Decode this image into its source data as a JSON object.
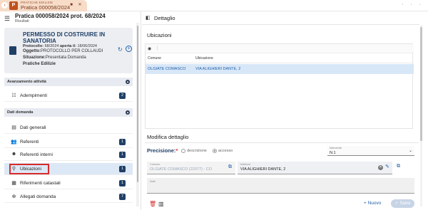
{
  "tab": {
    "app_name": "PRATICHE EDILIZIE",
    "title": "Pratica 000058/2024",
    "pin_icon": "pin-icon",
    "close_icon": "close-icon"
  },
  "window_controls": "· · ·",
  "left": {
    "header_title": "Pratica 000058/2024 prot. 68/2024",
    "header_subtitle": "Risultati",
    "card": {
      "title": "PERMESSO DI COSTRUIRE IN SANATORIA",
      "protocollo_label": "Protocollo:",
      "protocollo_value": "68/2024",
      "aperta_label": "aperta il:",
      "aperta_value": "18/06/2024",
      "oggetto_label": "Oggetto:",
      "oggetto_value": "PROTOCOLLO PER COLLAUDI",
      "situazione_label": "Situazione:",
      "situazione_value": "Presentata Domanda",
      "tipo": "Pratiche Edilizie"
    },
    "section_avanzamento": "Avanzamento attività",
    "adempimenti": {
      "label": "Adempimenti",
      "count": "2"
    },
    "section_dati": "Dati domanda",
    "items": [
      {
        "label": "Dati generali",
        "count": ""
      },
      {
        "label": "Referenti",
        "count": "1"
      },
      {
        "label": "Referenti interni",
        "count": "1"
      },
      {
        "label": "Ubicazioni",
        "count": "1"
      },
      {
        "label": "Riferimenti catastali",
        "count": "1"
      },
      {
        "label": "Allegati domanda",
        "count": "7"
      }
    ]
  },
  "right": {
    "title": "Dettaglio",
    "ubicazioni_title": "Ubicazioni",
    "table": {
      "columns": [
        "Comune",
        "Ubicazione"
      ],
      "rows": [
        {
          "comune": "OLGIATE COMASCO",
          "ubicazione": "VIA ALIGHIERI DANTE, 2"
        }
      ]
    },
    "modifica_title": "Modifica dettaglio",
    "precisione_label": "Precisione:",
    "precisione_required": "*",
    "radio_descrizione": "descrizione",
    "radio_accesso": "accesso",
    "intervento_label": "Intervento",
    "intervento_value": "N.1",
    "comune_label": "Comune",
    "comune_value": "OLGIATE COMASCO (22077) - CO",
    "indirizzo_label": "Indirizzo",
    "indirizzo_value": "VIA ALIGHIERI DANTE, 2",
    "note_label": "Note",
    "nuovo_label": "Nuovo",
    "salva_label": "Salva"
  },
  "colors": {
    "tab_bg": "#f7dcc8",
    "brand": "#c0501e",
    "primary": "#1f3f66",
    "link": "#1f5fa8",
    "selected_row": "#d8e7f7",
    "highlight_box": "#d62b2b"
  }
}
